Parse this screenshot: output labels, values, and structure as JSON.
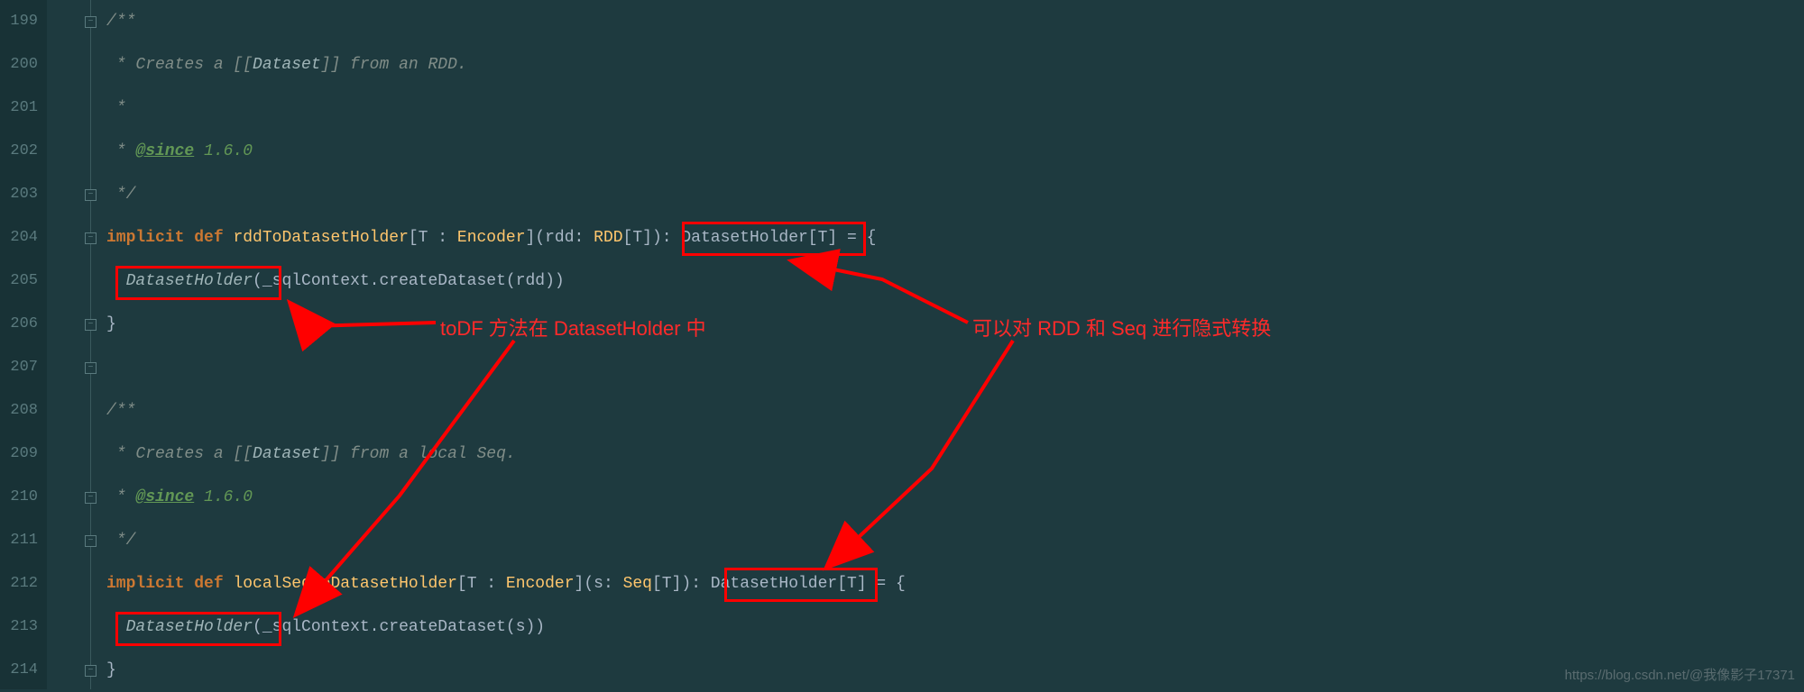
{
  "line_numbers": [
    "199",
    "200",
    "201",
    "202",
    "203",
    "204",
    "205",
    "206",
    "207",
    "208",
    "209",
    "210",
    "211",
    "212",
    "213",
    "214"
  ],
  "code": {
    "l199": "/**",
    "l200_pre": " * Creates a [[",
    "l200_typ": "Dataset",
    "l200_post": "]] from an RDD.",
    "l201": " *",
    "l202_pre": " * ",
    "l202_tag": "@since",
    "l202_ver": " 1.6.0",
    "l203": " */",
    "l204_kw1": "implicit ",
    "l204_kw2": "def ",
    "l204_name": "rddToDatasetHolder",
    "l204_sig1": "[T : ",
    "l204_enc": "Encoder",
    "l204_sig2": "]",
    "l204_par1": "(rdd: ",
    "l204_rdd": "RDD",
    "l204_par2": "[T])",
    "l204_ret": ": DatasetHolder[T] = {",
    "l205_pre": "  ",
    "l205_dh": "DatasetHolder",
    "l205_call": "(_sqlContext.createDataset(rdd))",
    "l206": "}",
    "l208": "/**",
    "l209_pre": " * Creates a [[",
    "l209_typ": "Dataset",
    "l209_post": "]] from a local Seq.",
    "l210_pre": " * ",
    "l210_tag": "@since",
    "l210_ver": " 1.6.0",
    "l211": " */",
    "l212_kw1": "implicit ",
    "l212_kw2": "def ",
    "l212_name": "localSeqToDatasetHolder",
    "l212_sig1": "[T : ",
    "l212_enc": "Encoder",
    "l212_sig2": "]",
    "l212_par1": "(s: ",
    "l212_seq": "Seq",
    "l212_par2": "[T])",
    "l212_ret": ": DatasetHolder[T] = {",
    "l213_pre": "  ",
    "l213_dh": "DatasetHolder",
    "l213_call": "(_sqlContext.createDataset(s))",
    "l214": "}"
  },
  "annotations": {
    "left": "toDF 方法在 DatasetHolder 中",
    "right": "可以对 RDD 和 Seq 进行隐式转换"
  },
  "watermark": "https://blog.csdn.net/@我像影子17371"
}
